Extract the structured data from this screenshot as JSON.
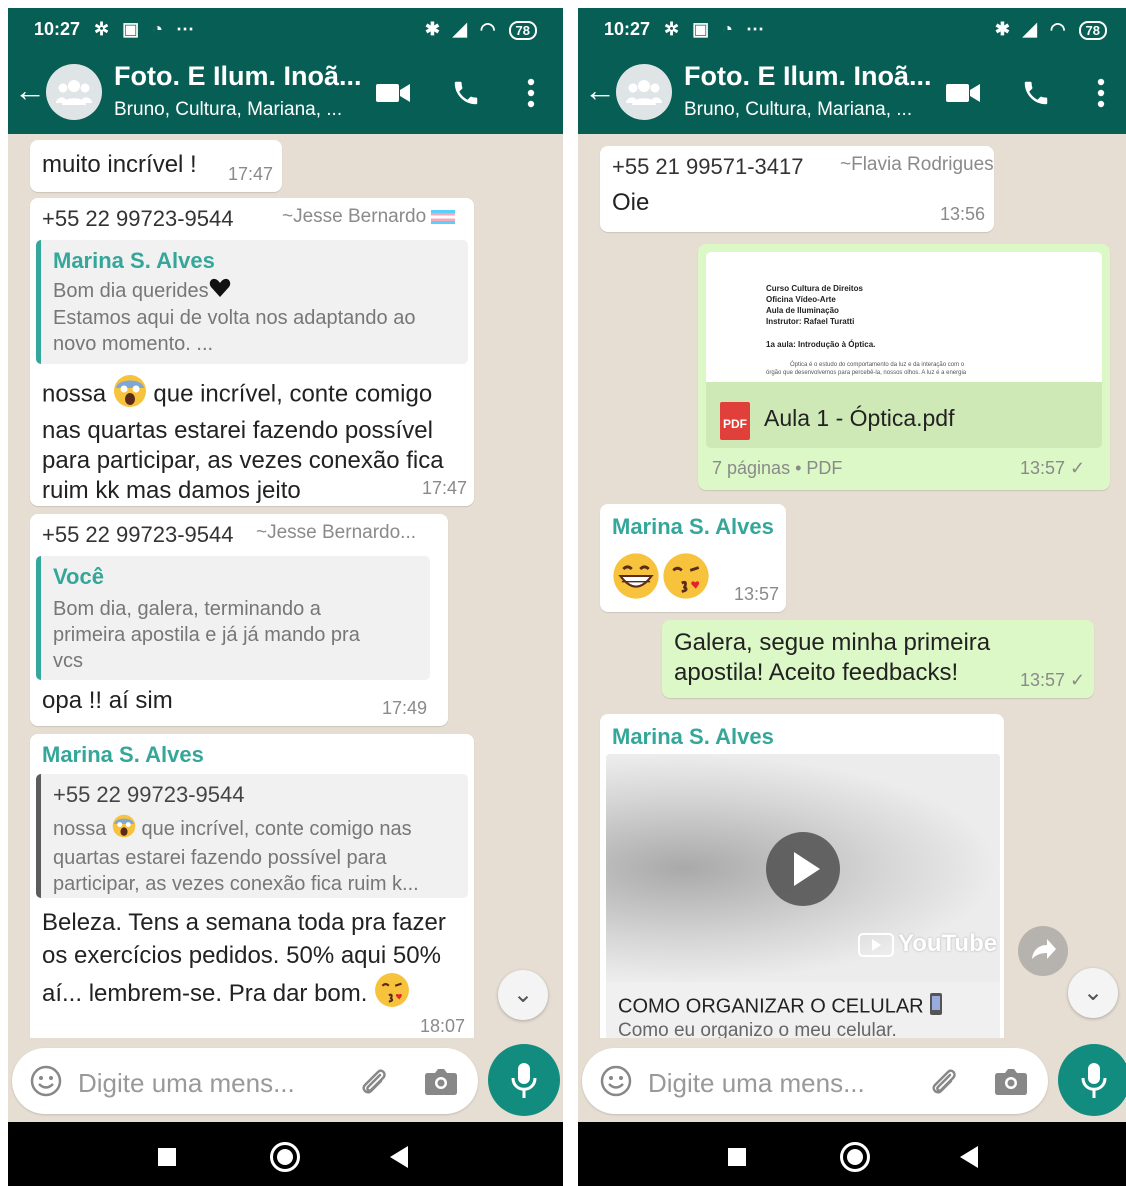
{
  "status_bar": {
    "time": "10:27",
    "battery": "78"
  },
  "chat_header": {
    "title": "Foto. E Ilum. Inoã...",
    "subtitle": "Bruno, Cultura, Mariana, ..."
  },
  "input": {
    "placeholder": "Digite uma mens..."
  },
  "left_messages": {
    "m1": {
      "text": "muito incrível !",
      "time": "17:47"
    },
    "m2": {
      "phone": "+55 22 99723-9544",
      "name": "~Jesse Bernardo",
      "quote_author": "Marina S. Alves",
      "quote_line1": "Bom dia querides",
      "quote_line2": "Estamos aqui de volta nos adaptando ao",
      "quote_line3": "novo momento. ...",
      "text_a": "nossa",
      "text_b": "que incrível, conte comigo",
      "text_line2": "nas quartas estarei fazendo possível",
      "text_line3": "para participar, as vezes conexão fica",
      "text_line4": "ruim kk mas damos jeito",
      "time": "17:47"
    },
    "m3": {
      "phone": "+55 22 99723-9544",
      "name": "~Jesse Bernardo...",
      "quote_author": "Você",
      "quote_line1": "Bom dia, galera, terminando a",
      "quote_line2": "primeira apostila e já já mando pra",
      "quote_line3": "vcs",
      "text": "opa !! aí sim",
      "time": "17:49"
    },
    "m4": {
      "author": "Marina S. Alves",
      "quote_author": "+55 22 99723-9544",
      "quote_line1_a": "nossa",
      "quote_line1_b": "que incrível, conte comigo nas",
      "quote_line2": "quartas estarei fazendo possível para",
      "quote_line3": "participar, as vezes conexão fica ruim k...",
      "text_line1": "Beleza. Tens a semana toda pra fazer",
      "text_line2": "os exercícios pedidos. 50% aqui 50%",
      "text_line3": "aí... lembrem-se. Pra dar bom.",
      "time": "18:07"
    }
  },
  "right_messages": {
    "m1": {
      "phone": "+55 21 99571-3417",
      "name": "~Flavia Rodrigues",
      "text": "Oie",
      "time": "13:56"
    },
    "m2": {
      "pdf_lines": [
        "Curso Cultura de Direitos",
        "Oficina Vídeo-Arte",
        "Aula de Iluminação",
        "Instrutor: Rafael Turatti",
        "1a aula: Introdução à Óptica."
      ],
      "pdf_body_1": "Óptica é o estudo do comportamento da luz e da interação com o",
      "pdf_body_2": "órgão que desenvolvemos para percebê-la, nossos olhos. A luz é a energia",
      "pdf_icon_label": "PDF",
      "filename": "Aula 1 - Óptica.pdf",
      "meta": "7 páginas • PDF",
      "time": "13:57 ✓"
    },
    "m3": {
      "author": "Marina S. Alves",
      "time": "13:57"
    },
    "m4": {
      "text_line1": "Galera, segue minha primeira",
      "text_line2": "apostila! Aceito feedbacks!",
      "time": "13:57 ✓"
    },
    "m5": {
      "author": "Marina S. Alves",
      "yt_logo": "YouTube",
      "yt_title": "COMO ORGANIZAR O CELULAR",
      "yt_desc": "Como eu organizo o meu celular."
    }
  },
  "colors": {
    "header": "#075e54",
    "accent": "#128c7e",
    "author": "#35a79a",
    "outgoing_bubble": "#dcf8c6",
    "chat_bg": "#e6ded3"
  },
  "icons": [
    "back-arrow-icon",
    "group-avatar-icon",
    "video-call-icon",
    "phone-icon",
    "more-options-icon",
    "emoji-icon",
    "attach-icon",
    "camera-icon",
    "mic-icon",
    "scroll-down-icon",
    "forward-icon",
    "pdf-icon",
    "youtube-play-icon"
  ]
}
